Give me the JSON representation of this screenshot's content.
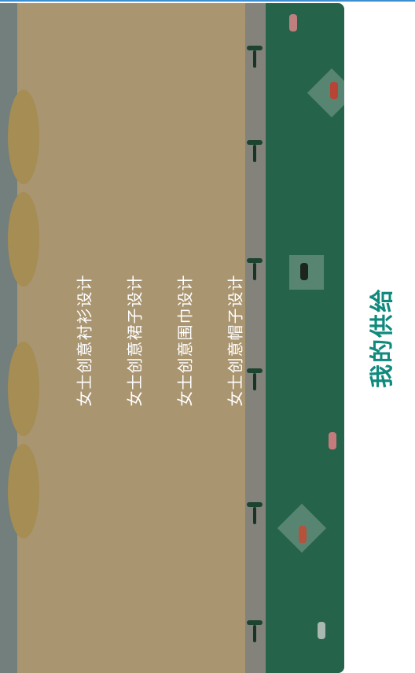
{
  "title": "我的供给",
  "items": [
    {
      "label": "女士创意衬衫设计"
    },
    {
      "label": "女士创意裙子设计"
    },
    {
      "label": "女士创意围巾设计"
    },
    {
      "label": "女士创意帽子设计"
    }
  ],
  "colors": {
    "title": "#0f8a7d",
    "item_text": "#ffffff",
    "grass": "#2a6c52",
    "sand": "#b9a27b",
    "top_border": "#3f8fd0"
  }
}
